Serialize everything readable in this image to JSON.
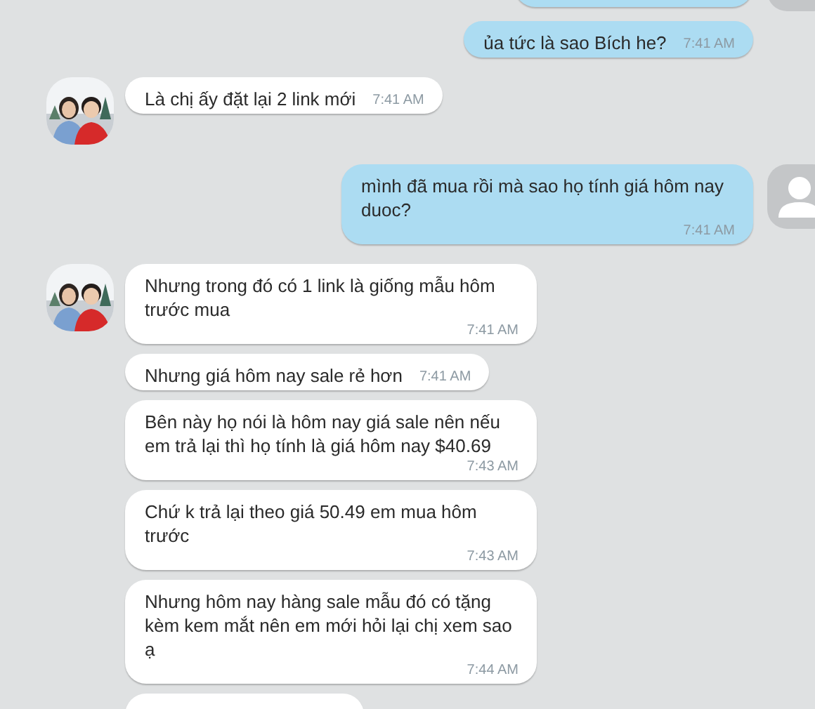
{
  "messages": [
    {
      "kind": "outgoing",
      "avatar": true
    },
    {
      "kind": "outgoing",
      "avatar": false,
      "text": "ủa tức là sao Bích he?",
      "time": "7:41 AM"
    },
    {
      "kind": "incoming",
      "avatar": true,
      "text": "Là chị ấy đặt lại 2 link mới",
      "time": "7:41 AM"
    },
    {
      "kind": "outgoing",
      "avatar": true,
      "text": "mình đã mua rồi mà sao họ tính giá hôm nay duoc?",
      "time": "7:41 AM"
    },
    {
      "kind": "incoming",
      "avatar": true,
      "text": "Nhưng trong đó có 1 link là giống mẫu hôm trước mua",
      "time": "7:41 AM"
    },
    {
      "kind": "incoming",
      "avatar": false,
      "text": "Nhưng giá hôm nay sale rẻ hơn",
      "time": "7:41 AM"
    },
    {
      "kind": "incoming",
      "avatar": false,
      "text": "Bên này họ nói là hôm nay giá sale nên nếu em trả lại thì họ tính là giá hôm nay $40.69",
      "time": "7:43 AM"
    },
    {
      "kind": "incoming",
      "avatar": false,
      "text": "Chứ k trả lại theo giá 50.49 em mua hôm trước",
      "time": "7:43 AM"
    },
    {
      "kind": "incoming",
      "avatar": false,
      "text": "Nhưng hôm nay hàng sale mẫu đó có tặng kèm kem mắt nên em mới hỏi lại chị xem sao ạ",
      "time": "7:44 AM"
    },
    {
      "kind": "incoming",
      "avatar": false
    }
  ]
}
